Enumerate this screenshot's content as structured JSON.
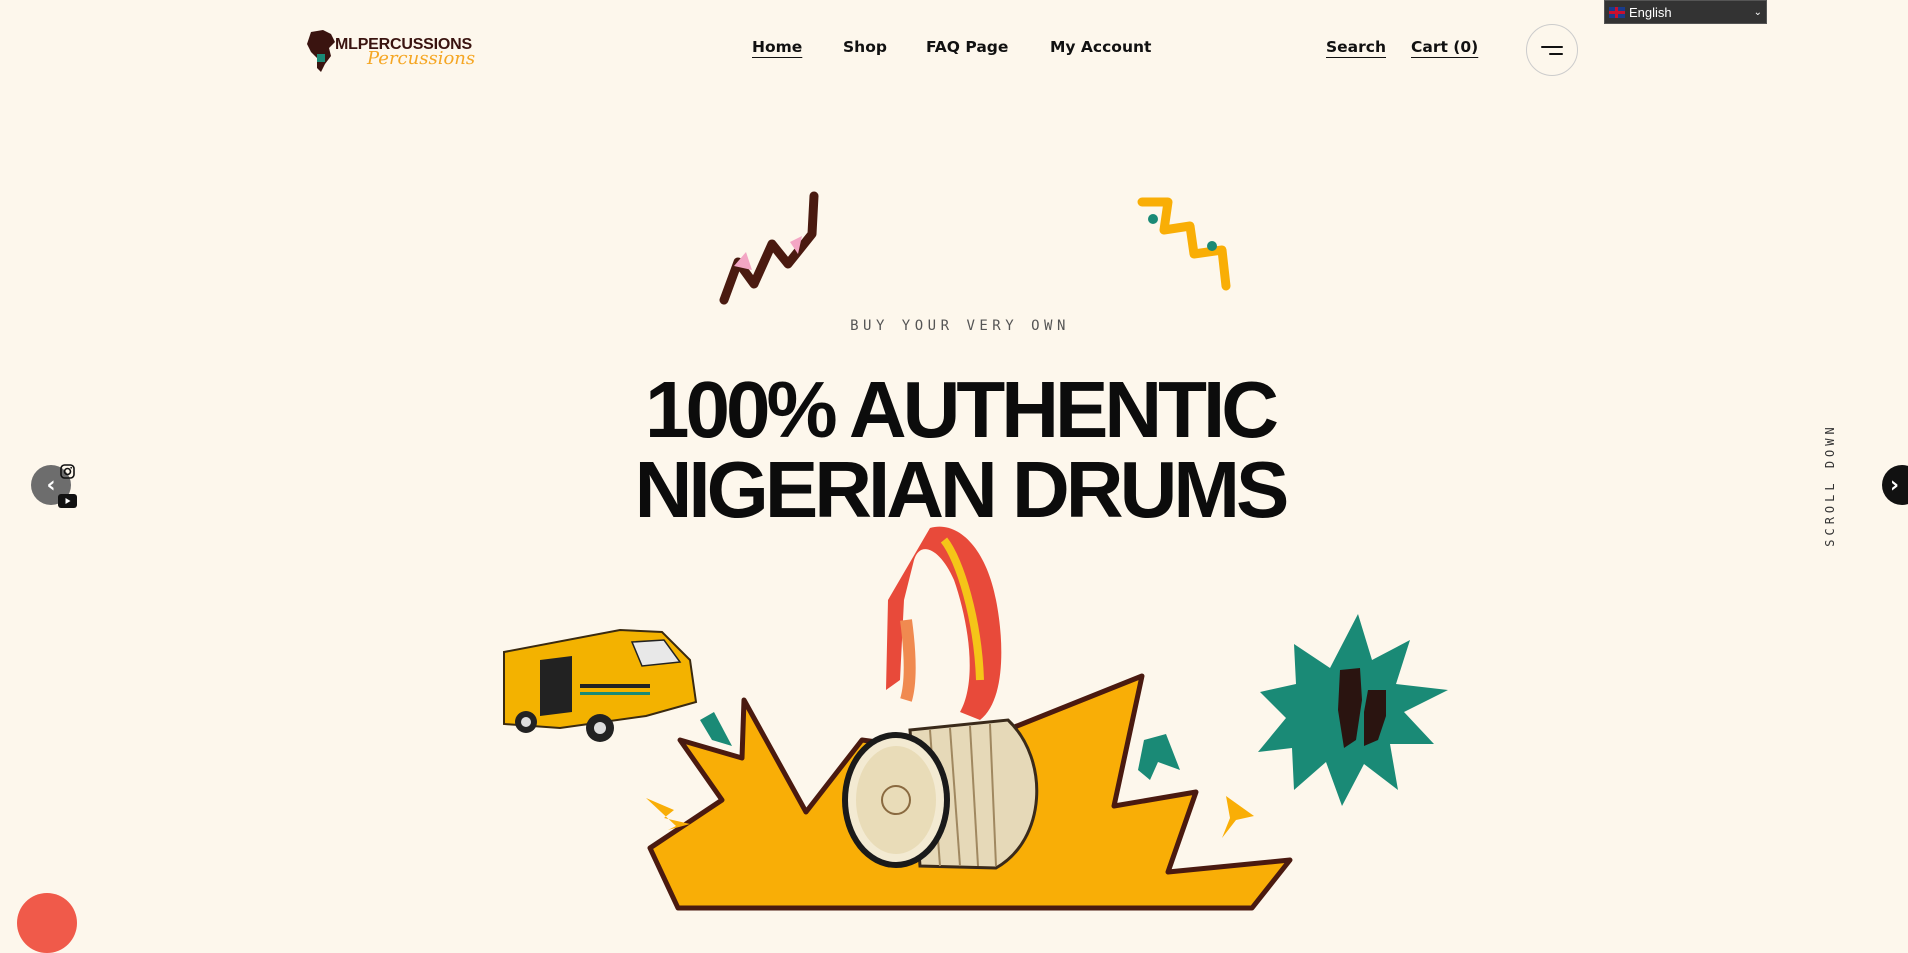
{
  "brand": {
    "name": "MLPERCUSSIONS",
    "logo_script": "Percussions"
  },
  "nav": {
    "items": [
      {
        "label": "Home",
        "active": true
      },
      {
        "label": "Shop",
        "active": false
      },
      {
        "label": "FAQ Page",
        "active": false
      },
      {
        "label": "My Account",
        "active": false
      }
    ]
  },
  "utility": {
    "search": "Search",
    "cart": "Cart (0)"
  },
  "language": {
    "selected": "English"
  },
  "hero": {
    "eyebrow": "BUY YOUR VERY OWN",
    "headline_line1": "100% AUTHENTIC",
    "headline_line2": "NIGERIAN DRUMS",
    "scroll_hint": "SCROLL DOWN"
  },
  "slider": {
    "prev_icon": "chevron-left-icon",
    "next_icon": "chevron-right-icon"
  },
  "social": [
    "instagram-icon",
    "youtube-icon"
  ],
  "colors": {
    "background": "#fdf7ec",
    "accent_yellow": "#f9ae06",
    "accent_teal": "#1a8a76",
    "brown": "#4a1a10",
    "pink": "#f3a6c4",
    "chat": "#f05a4a"
  }
}
